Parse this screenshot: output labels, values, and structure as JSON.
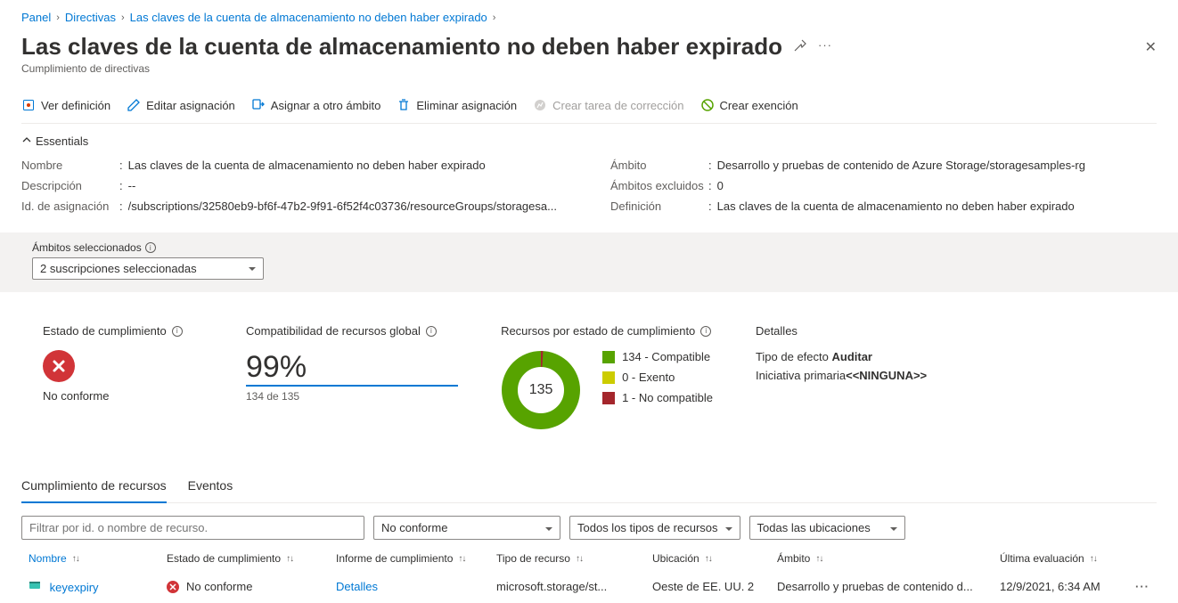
{
  "breadcrumb": {
    "items": [
      "Panel",
      "Directivas",
      "Las claves de la cuenta de almacenamiento no deben haber expirado"
    ]
  },
  "header": {
    "title": "Las claves de la cuenta de almacenamiento no deben haber expirado",
    "subtitle": "Cumplimiento de directivas"
  },
  "toolbar": {
    "view_def": "Ver definición",
    "edit_assign": "Editar asignación",
    "assign_other": "Asignar a otro ámbito",
    "delete_assign": "Eliminar asignación",
    "create_task": "Crear tarea de corrección",
    "create_exemption": "Crear exención"
  },
  "essentials": {
    "header": "Essentials",
    "name_label": "Nombre",
    "name_value": "Las claves de la cuenta de almacenamiento no deben haber expirado",
    "desc_label": "Descripción",
    "desc_value": "--",
    "assign_id_label": "Id. de asignación",
    "assign_id_value": "/subscriptions/32580eb9-bf6f-47b2-9f91-6f52f4c03736/resourceGroups/storagesa...",
    "scope_label": "Ámbito",
    "scope_value": "Desarrollo y pruebas de contenido de Azure Storage/storagesamples-rg",
    "excluded_label": "Ámbitos excluidos",
    "excluded_value": "0",
    "definition_label": "Definición",
    "definition_value": "Las claves de la cuenta de almacenamiento no deben haber expirado"
  },
  "scope_picker": {
    "label": "Ámbitos seleccionados",
    "value": "2 suscripciones seleccionadas"
  },
  "summary": {
    "compliance_state": {
      "label": "Estado de cumplimiento",
      "status": "No conforme"
    },
    "global": {
      "label": "Compatibilidad de recursos global",
      "percent": "99%",
      "sub": "134 de 135"
    },
    "by_state": {
      "label": "Recursos por estado de cumplimiento",
      "center": "135",
      "items": [
        {
          "color": "#57a300",
          "text": "134 - Compatible"
        },
        {
          "color": "#cccc00",
          "text": "0 - Exento"
        },
        {
          "color": "#a4262c",
          "text": "1 - No compatible"
        }
      ]
    },
    "details": {
      "label": "Detalles",
      "effect_label": "Tipo de efecto",
      "effect_value": "Auditar",
      "initiative_label": "Iniciativa primaria",
      "initiative_value": "<<NINGUNA>>"
    }
  },
  "tabs": {
    "resources": "Cumplimiento de recursos",
    "events": "Eventos"
  },
  "filters": {
    "placeholder": "Filtrar por id. o nombre de recurso.",
    "compliance": "No conforme",
    "resource_type": "Todos los tipos de recursos",
    "location": "Todas las ubicaciones"
  },
  "table": {
    "headers": {
      "name": "Nombre",
      "state": "Estado de cumplimiento",
      "report": "Informe de cumplimiento",
      "type": "Tipo de recurso",
      "location": "Ubicación",
      "scope": "Ámbito",
      "last_eval": "Última evaluación"
    },
    "rows": [
      {
        "name": "keyexpiry",
        "state": "No conforme",
        "report": "Detalles",
        "type": "microsoft.storage/st...",
        "location": "Oeste de EE. UU. 2",
        "scope": "Desarrollo y pruebas de contenido d...",
        "last_eval": "12/9/2021, 6:34 AM"
      }
    ]
  }
}
